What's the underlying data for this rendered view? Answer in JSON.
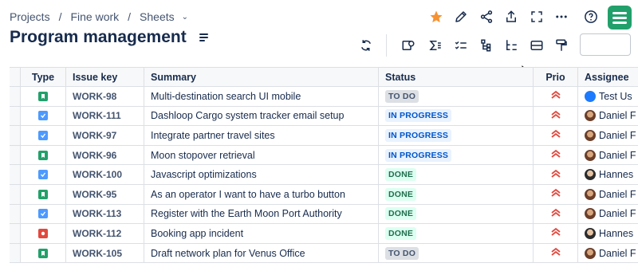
{
  "breadcrumb": {
    "items": [
      "Projects",
      "Fine work",
      "Sheets"
    ]
  },
  "page": {
    "title": "Program management"
  },
  "search": {
    "placeholder": ""
  },
  "columns": {
    "type": "Type",
    "key": "Issue key",
    "summary": "Summary",
    "status": "Status",
    "prio": "Prio",
    "assignee": "Assignee"
  },
  "rows": [
    {
      "type": "story",
      "key": "WORK-98",
      "summary": "Multi-destination search UI mobile",
      "status": "TO DO",
      "status_kind": "todo",
      "assignee": "Test Us"
    },
    {
      "type": "task",
      "key": "WORK-111",
      "summary": "Dashloop Cargo system tracker email setup",
      "status": "IN PROGRESS",
      "status_kind": "prog",
      "assignee": "Daniel F"
    },
    {
      "type": "task",
      "key": "WORK-97",
      "summary": "Integrate partner travel sites",
      "status": "IN PROGRESS",
      "status_kind": "prog",
      "assignee": "Daniel F"
    },
    {
      "type": "story",
      "key": "WORK-96",
      "summary": "Moon stopover retrieval",
      "status": "IN PROGRESS",
      "status_kind": "prog",
      "assignee": "Daniel F"
    },
    {
      "type": "task",
      "key": "WORK-100",
      "summary": "Javascript optimizations",
      "status": "DONE",
      "status_kind": "done",
      "assignee": "Hannes"
    },
    {
      "type": "story",
      "key": "WORK-95",
      "summary": "As an operator I want to have a turbo button",
      "status": "DONE",
      "status_kind": "done",
      "assignee": "Daniel F"
    },
    {
      "type": "task",
      "key": "WORK-113",
      "summary": "Register with the Earth Moon Port Authority",
      "status": "DONE",
      "status_kind": "done",
      "assignee": "Daniel F"
    },
    {
      "type": "bug",
      "key": "WORK-112",
      "summary": "Booking app incident",
      "status": "DONE",
      "status_kind": "done",
      "assignee": "Hannes"
    },
    {
      "type": "story",
      "key": "WORK-105",
      "summary": "Draft network plan for Venus Office",
      "status": "TO DO",
      "status_kind": "todo",
      "assignee": "Daniel F"
    }
  ],
  "colors": {
    "accent": "#22a06b",
    "star": "#f79232",
    "priority": "#e2483d"
  }
}
